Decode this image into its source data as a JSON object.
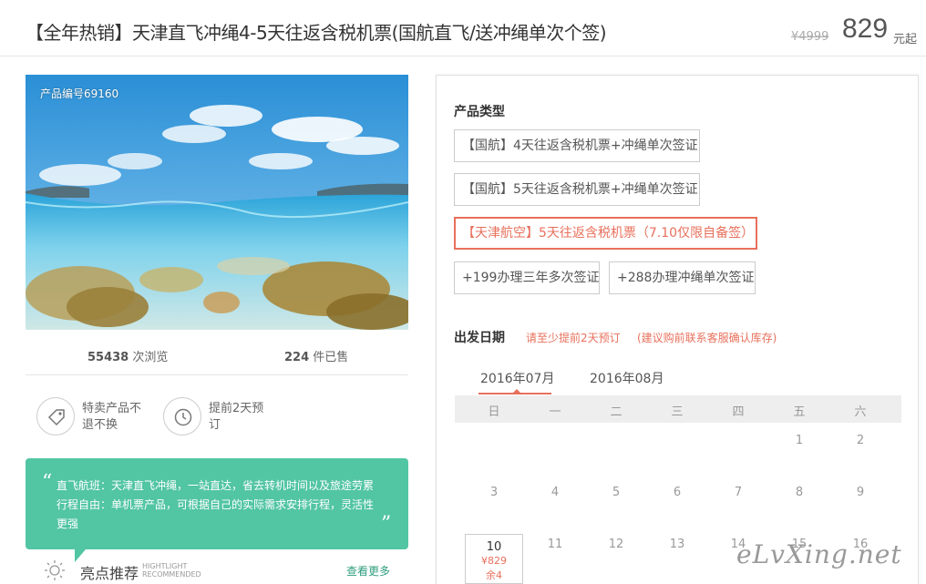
{
  "header": {
    "title": "【全年热销】天津直飞冲绳4-5天往返含税机票(国航直飞/送冲绳单次个签)",
    "price_old": "¥4999",
    "price_new": "829",
    "price_unit": "元起"
  },
  "photo": {
    "product_code": "产品编号69160"
  },
  "stats": {
    "views_count": "55438",
    "views_label": "次浏览",
    "sold_count": "224",
    "sold_label": "件已售"
  },
  "features": [
    {
      "icon": "tag-icon",
      "text": "特卖产品不退不换"
    },
    {
      "icon": "clock-icon",
      "text": "提前2天预订"
    }
  ],
  "quote": {
    "text": "直飞航班：天津直飞冲绳，一站直达，省去转机时间以及旅途劳累 行程自由：单机票产品，可根据自己的实际需求安排行程，灵活性更强"
  },
  "highlight": {
    "title": "亮点推荐",
    "subtitle_en": "HIGHTLIGHT RECOMMENDED",
    "more_label": "查看更多"
  },
  "product_type": {
    "label": "产品类型",
    "options": [
      "【国航】4天往返含税机票+冲绳单次签证",
      "【国航】5天往返含税机票+冲绳单次签证",
      "【天津航空】5天往返含税机票（7.10仅限自备签）",
      "+199办理三年多次签证",
      "+288办理冲绳单次签证"
    ],
    "selected_index": 2
  },
  "departure": {
    "label": "出发日期",
    "note1": "请至少提前2天预订",
    "note2": "(建议购前联系客服确认库存)",
    "months": [
      "2016年07月",
      "2016年08月"
    ],
    "active_month_index": 0,
    "weekdays": [
      "日",
      "一",
      "二",
      "三",
      "四",
      "五",
      "六"
    ],
    "row1": [
      "1",
      "2"
    ],
    "row2": [
      "3",
      "4",
      "5",
      "6",
      "7",
      "8",
      "9"
    ],
    "row3": [
      "10",
      "11",
      "12",
      "13",
      "14",
      "15",
      "16"
    ],
    "selected_day": {
      "day": "10",
      "price": "¥829",
      "left": "余4"
    }
  },
  "watermark": "eLvXing.net",
  "colors": {
    "accent": "#e8705c",
    "teal": "#52c5a3"
  }
}
